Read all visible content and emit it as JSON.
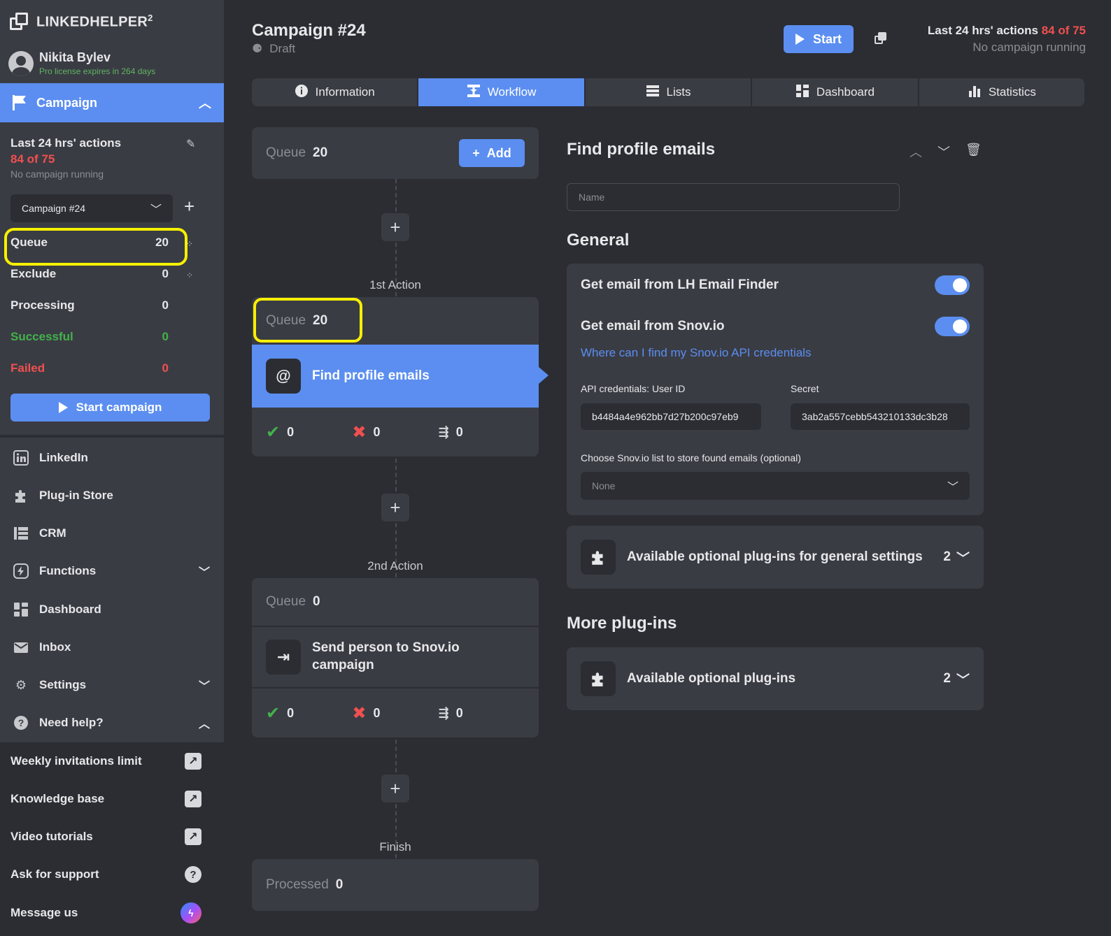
{
  "brand": {
    "name": "LINKEDHELPER",
    "sup": "2"
  },
  "user": {
    "name": "Nikita Bylev",
    "license": "Pro license expires in 264 days"
  },
  "sidebar": {
    "campaign_label": "Campaign",
    "actions_title": "Last 24 hrs' actions",
    "actions_count": "84 of 75",
    "actions_status": "No campaign running",
    "campaign_select": "Campaign #24",
    "stats": [
      {
        "label": "Queue",
        "value": "20"
      },
      {
        "label": "Exclude",
        "value": "0"
      },
      {
        "label": "Processing",
        "value": "0"
      },
      {
        "label": "Successful",
        "value": "0"
      },
      {
        "label": "Failed",
        "value": "0"
      }
    ],
    "start_campaign": "Start campaign",
    "nav": [
      {
        "label": "LinkedIn",
        "icon": "linkedin-icon"
      },
      {
        "label": "Plug-in Store",
        "icon": "puzzle-icon"
      },
      {
        "label": "CRM",
        "icon": "crm-icon"
      },
      {
        "label": "Functions",
        "icon": "bolt-icon"
      },
      {
        "label": "Dashboard",
        "icon": "dashboard-icon"
      },
      {
        "label": "Inbox",
        "icon": "mail-icon"
      },
      {
        "label": "Settings",
        "icon": "gear-icon"
      },
      {
        "label": "Need help?",
        "icon": "question-icon"
      }
    ],
    "help": [
      {
        "label": "Weekly invitations limit"
      },
      {
        "label": "Knowledge base"
      },
      {
        "label": "Video tutorials"
      },
      {
        "label": "Ask for support"
      },
      {
        "label": "Message us"
      }
    ]
  },
  "header": {
    "title": "Campaign #24",
    "status": "Draft",
    "start": "Start",
    "actions_title": "Last 24 hrs' actions",
    "actions_count": "84 of 75",
    "actions_status": "No campaign running"
  },
  "tabs": [
    {
      "label": "Information"
    },
    {
      "label": "Workflow"
    },
    {
      "label": "Lists"
    },
    {
      "label": "Dashboard"
    },
    {
      "label": "Statistics"
    }
  ],
  "workflow": {
    "queue_label": "Queue",
    "top_queue": "20",
    "add": "Add",
    "step1_label": "1st Action",
    "step1_queue": "20",
    "step1_action": "Find profile emails",
    "step1_ok": "0",
    "step1_fail": "0",
    "step1_skip": "0",
    "step2_label": "2nd Action",
    "step2_queue": "0",
    "step2_action": "Send person to Snov.io campaign",
    "step2_ok": "0",
    "step2_fail": "0",
    "step2_skip": "0",
    "finish_label": "Finish",
    "processed_label": "Processed",
    "processed": "0"
  },
  "panel": {
    "title": "Find profile emails",
    "name_placeholder": "Name",
    "general": "General",
    "toggle1": "Get email from LH Email Finder",
    "toggle2": "Get email from Snov.io",
    "link": "Where can I find my Snov.io API credentials",
    "userid_label": "API credentials: User ID",
    "userid_value": "b4484a4e962bb7d27b200c97eb9",
    "secret_label": "Secret",
    "secret_value": "3ab2a557cebb543210133dc3b28",
    "list_label": "Choose Snov.io list to store found emails (optional)",
    "list_value": "None",
    "plugins_general": "Available optional plug-ins for general settings",
    "plugins_general_count": "2",
    "more": "More plug-ins",
    "plugins_more": "Available optional plug-ins",
    "plugins_more_count": "2"
  },
  "colors": {
    "accent": "#5b8ef0",
    "danger": "#f0504f",
    "success": "#43b14b",
    "highlight": "#f7f000"
  }
}
